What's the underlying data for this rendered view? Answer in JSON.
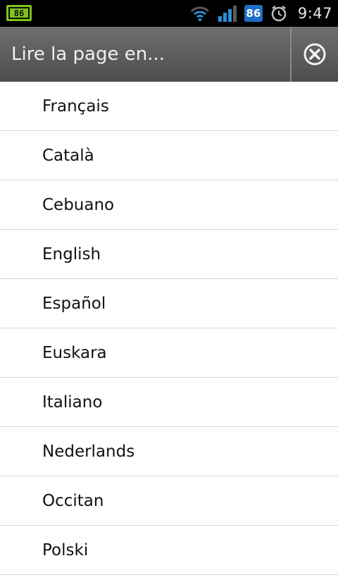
{
  "status_bar": {
    "battery_app_value": "86",
    "notification_badge": "86",
    "time": "9:47",
    "icons": [
      "battery-app-icon",
      "wifi-icon",
      "signal-icon",
      "notification-badge-icon",
      "alarm-icon"
    ]
  },
  "dialog": {
    "title": "Lire la page en...",
    "close_icon": "close-circle-icon"
  },
  "languages": [
    "Français",
    "Català",
    "Cebuano",
    "English",
    "Español",
    "Euskara",
    "Italiano",
    "Nederlands",
    "Occitan",
    "Polski"
  ],
  "colors": {
    "statusbar_bg": "#000000",
    "titlebar_bg": "#5c5c5c",
    "battery_green": "#7fc31c",
    "badge_blue": "#1e6fc4",
    "signal_blue": "#2a8fd8"
  }
}
